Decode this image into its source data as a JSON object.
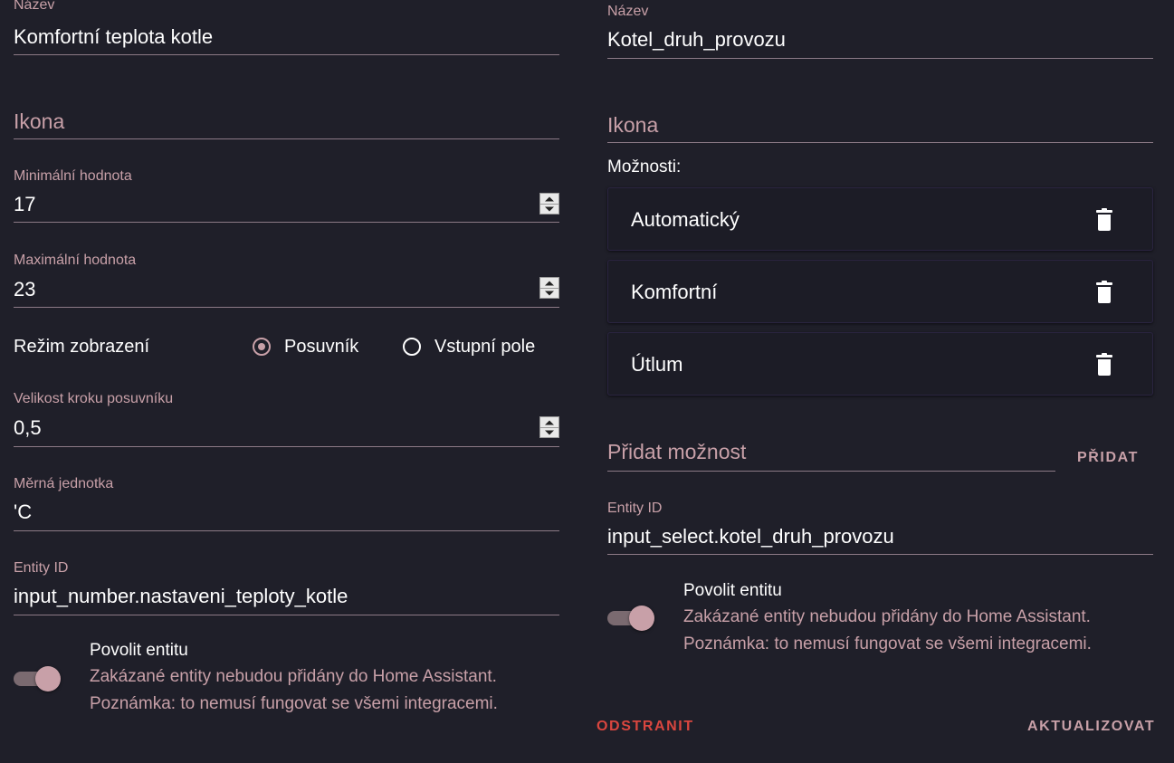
{
  "left": {
    "name": {
      "label": "Název",
      "value": "Komfortní teplota kotle"
    },
    "icon": {
      "placeholder": "Ikona"
    },
    "min": {
      "label": "Minimální hodnota",
      "value": "17"
    },
    "max": {
      "label": "Maximální hodnota",
      "value": "23"
    },
    "mode": {
      "label": "Režim zobrazení",
      "options": [
        {
          "label": "Posuvník",
          "selected": true
        },
        {
          "label": "Vstupní pole",
          "selected": false
        }
      ]
    },
    "step": {
      "label": "Velikost kroku posuvníku",
      "value": "0,5"
    },
    "unit": {
      "label": "Měrná jednotka",
      "value": "'C"
    },
    "entity": {
      "label": "Entity ID",
      "value": "input_number.nastaveni_teploty_kotle"
    },
    "enable": {
      "title": "Povolit entitu",
      "desc1": "Zakázané entity nebudou přidány do Home Assistant.",
      "desc2": "Poznámka: to nemusí fungovat se všemi integracemi.",
      "on": true
    }
  },
  "right": {
    "name": {
      "label": "Název",
      "value": "Kotel_druh_provozu"
    },
    "icon": {
      "placeholder": "Ikona"
    },
    "options_label": "Možnosti:",
    "options": [
      "Automatický",
      "Komfortní",
      "Útlum"
    ],
    "add_option": {
      "placeholder": "Přidat možnost",
      "button": "PŘIDAT"
    },
    "entity": {
      "label": "Entity ID",
      "value": "input_select.kotel_druh_provozu"
    },
    "enable": {
      "title": "Povolit entitu",
      "desc1": "Zakázané entity nebudou přidány do Home Assistant.",
      "desc2": "Poznámka: to nemusí fungovat se všemi integracemi.",
      "on": true
    }
  },
  "footer": {
    "delete": "ODSTRANIT",
    "update": "AKTUALIZOVAT"
  },
  "colors": {
    "accent": "#c8a0a8",
    "danger": "#d9463f",
    "background": "#1f1f29"
  },
  "icons": {
    "delete_option": "trash-icon"
  }
}
